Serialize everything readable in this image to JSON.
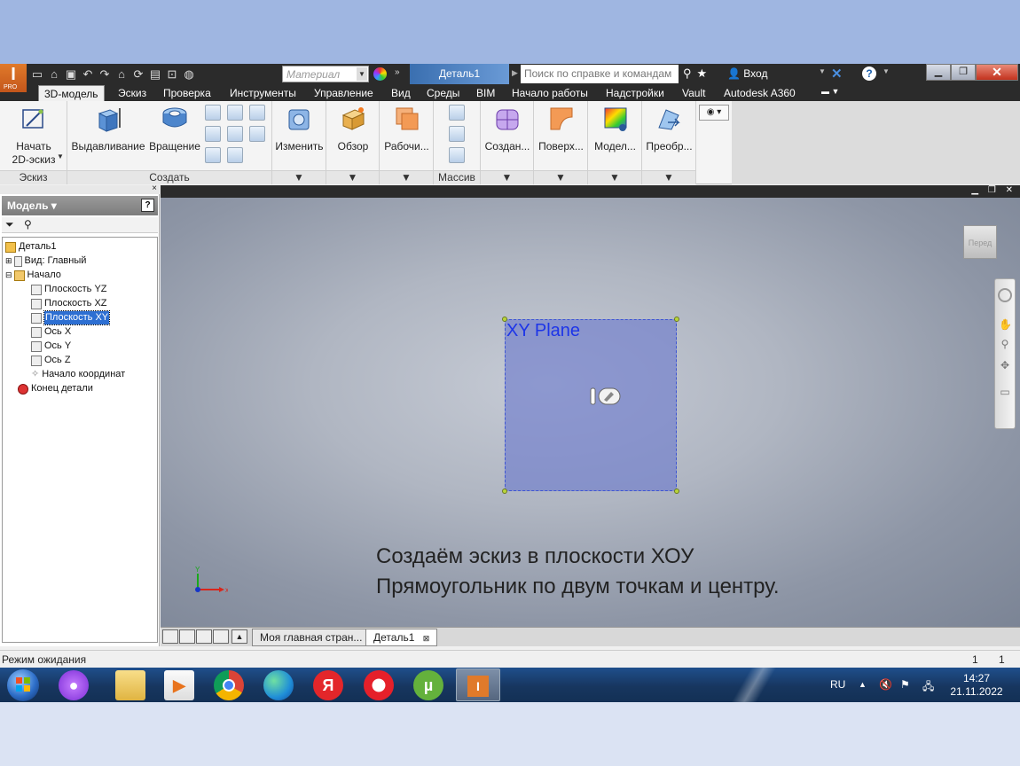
{
  "titlebar": {
    "material_placeholder": "Материал",
    "document_title": "Деталь1",
    "search_placeholder": "Поиск по справке и командам",
    "login_label": "Вход",
    "logo_badge": "PRO"
  },
  "tabs": [
    "3D-модель",
    "Эскиз",
    "Проверка",
    "Инструменты",
    "Управление",
    "Вид",
    "Среды",
    "BIM",
    "Начало работы",
    "Надстройки",
    "Vault",
    "Autodesk A360"
  ],
  "ribbon": {
    "sketch_button_line1": "Начать",
    "sketch_button_line2": "2D-эскиз",
    "sketch_panel": "Эскиз",
    "extrude": "Выдавливание",
    "revolve": "Вращение",
    "create_panel": "Создать",
    "modify": "Изменить",
    "explore": "Обзор",
    "work": "Рабочи...",
    "pattern_panel": "Массив",
    "create2": "Создан...",
    "surface": "Поверх...",
    "model": "Модел...",
    "convert": "Преобр..."
  },
  "browser": {
    "title": "Модель",
    "items": [
      "Деталь1",
      "Вид: Главный",
      "Начало",
      "Плоскость YZ",
      "Плоскость XZ",
      "Плоскость XY",
      "Ось X",
      "Ось Y",
      "Ось Z",
      "Начало координат",
      "Конец детали"
    ]
  },
  "viewport": {
    "viewcube_label": "Перед",
    "plane_label": "XY Plane",
    "caption_line1": "Создаём эскиз в плоскости ХОУ",
    "caption_line2": "Прямоугольник по двум точкам и центру.",
    "axis_x": "x",
    "axis_y": "Y"
  },
  "doc_tabs": [
    "Моя главная стран...",
    "Деталь1"
  ],
  "status": {
    "text": "Режим ожидания",
    "count1": "1",
    "count2": "1"
  },
  "taskbar": {
    "yandex_letter": "Я",
    "lang": "RU",
    "time": "14:27",
    "date": "21.11.2022"
  },
  "colors": {
    "plane_fill": "#6e7dcd",
    "plane_border": "#3c54d3",
    "plane_text": "#1d35e8",
    "selection": "#2d6fd2",
    "inventor_orange": "#e07a2a"
  }
}
